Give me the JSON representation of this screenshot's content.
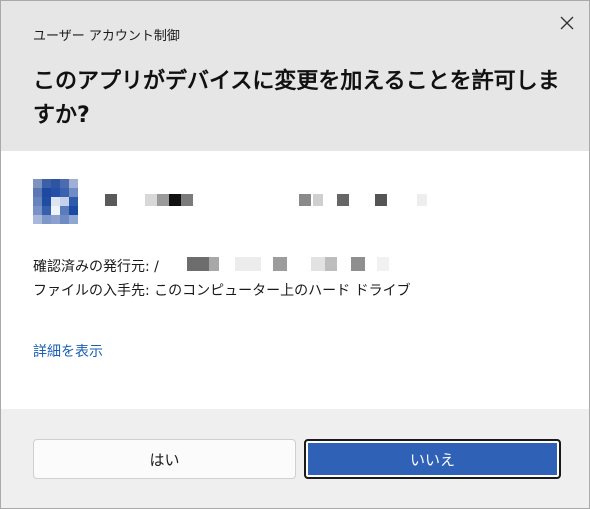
{
  "dialog": {
    "title": "ユーザー アカウント制御",
    "headline": "このアプリがデバイスに変更を加えることを許可しますか?",
    "close_icon": "close-icon"
  },
  "app": {
    "icon": "redacted-app-icon",
    "publisher_label": "確認済みの発行元:",
    "publisher_value_prefix": "/",
    "origin_line": "ファイルの入手先: このコンピューター上のハード ドライブ"
  },
  "details_link": "詳細を表示",
  "buttons": {
    "yes": "はい",
    "no": "いいえ"
  },
  "colors": {
    "header_bg": "#e6e6e6",
    "footer_bg": "#efefef",
    "accent": "#2f62b7",
    "link": "#1a5fb4"
  }
}
